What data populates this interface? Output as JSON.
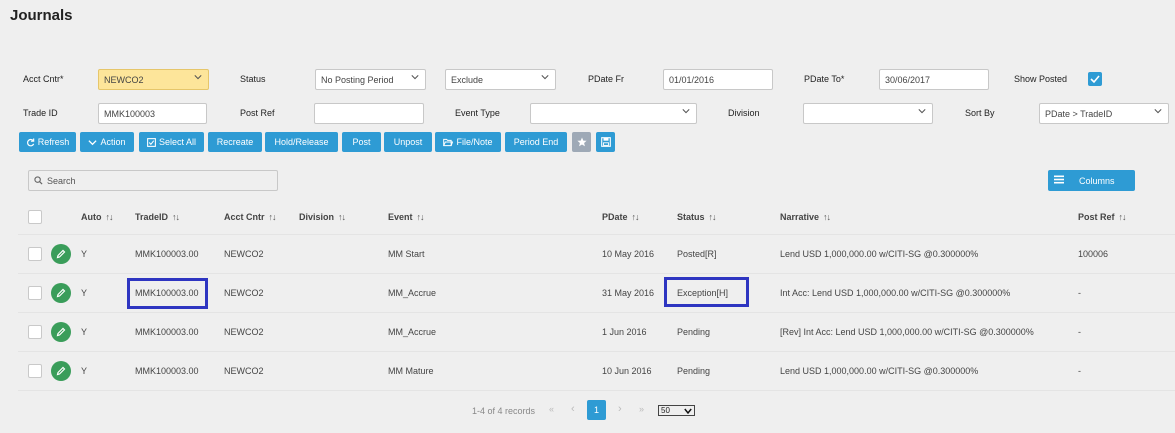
{
  "page": {
    "title": "Journals"
  },
  "filters": {
    "acct_cntr_label": "Acct Cntr*",
    "acct_cntr_value": "NEWCO2",
    "status_label": "Status",
    "status_value": "No Posting Period",
    "exclude_value": "Exclude",
    "pdate_fr_label": "PDate Fr",
    "pdate_fr_value": "01/01/2016",
    "pdate_to_label": "PDate To*",
    "pdate_to_value": "30/06/2017",
    "show_posted_label": "Show Posted",
    "show_posted_checked": true,
    "trade_id_label": "Trade ID",
    "trade_id_value": "MMK100003",
    "post_ref_label": "Post Ref",
    "post_ref_value": "",
    "event_type_label": "Event Type",
    "event_type_value": "",
    "division_label": "Division",
    "division_value": "",
    "sort_by_label": "Sort By",
    "sort_by_value": "PDate > TradeID"
  },
  "toolbar": {
    "refresh": "Refresh",
    "action": "Action",
    "select_all": "Select All",
    "recreate": "Recreate",
    "hold_release": "Hold/Release",
    "post": "Post",
    "unpost": "Unpost",
    "file_note": "File/Note",
    "period_end": "Period End"
  },
  "grid": {
    "search_placeholder": "Search",
    "columns_button": "Columns",
    "headers": {
      "auto": "Auto",
      "trade_id": "TradeID",
      "acct_cntr": "Acct Cntr",
      "division": "Division",
      "event": "Event",
      "pdate": "PDate",
      "status": "Status",
      "narrative": "Narrative",
      "post_ref": "Post Ref"
    },
    "sort_glyph": "↑↓",
    "rows": [
      {
        "auto": "Y",
        "trade_id": "MMK100003.00",
        "acct_cntr": "NEWCO2",
        "division": "",
        "event": "MM Start",
        "pdate": "10 May 2016",
        "status": "Posted[R]",
        "narrative": "Lend USD 1,000,000.00 w/CITI-SG @0.300000%",
        "post_ref": "100006"
      },
      {
        "auto": "Y",
        "trade_id": "MMK100003.00",
        "acct_cntr": "NEWCO2",
        "division": "",
        "event": "MM_Accrue",
        "pdate": "31 May 2016",
        "status": "Exception[H]",
        "narrative": "Int Acc: Lend USD 1,000,000.00 w/CITI-SG @0.300000%",
        "post_ref": "-"
      },
      {
        "auto": "Y",
        "trade_id": "MMK100003.00",
        "acct_cntr": "NEWCO2",
        "division": "",
        "event": "MM_Accrue",
        "pdate": "1 Jun 2016",
        "status": "Pending",
        "narrative": "[Rev] Int Acc: Lend USD 1,000,000.00 w/CITI-SG @0.300000%",
        "post_ref": "-"
      },
      {
        "auto": "Y",
        "trade_id": "MMK100003.00",
        "acct_cntr": "NEWCO2",
        "division": "",
        "event": "MM Mature",
        "pdate": "10 Jun 2016",
        "status": "Pending",
        "narrative": "Lend USD 1,000,000.00 w/CITI-SG @0.300000%",
        "post_ref": "-"
      }
    ]
  },
  "pager": {
    "summary": "1-4 of 4 records",
    "first": "«",
    "prev": "‹",
    "current_page": "1",
    "next": "›",
    "last": "»",
    "page_size": "50"
  },
  "colors": {
    "accent": "#2e9bd4",
    "highlight": "#2e35c1",
    "edit": "#3a9d5a",
    "yellow_input": "#fde59a"
  }
}
